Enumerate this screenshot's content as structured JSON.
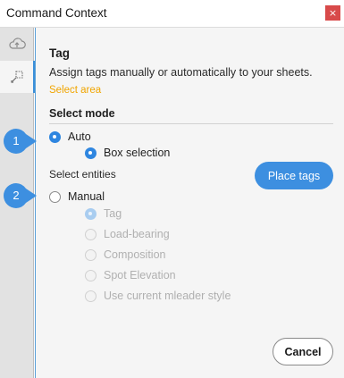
{
  "window": {
    "title": "Command Context",
    "close_glyph": "×"
  },
  "rail": {
    "items": [
      {
        "icon": "cloud-upload-icon"
      },
      {
        "icon": "tag-select-icon"
      }
    ]
  },
  "panel": {
    "heading": "Tag",
    "description": "Assign tags manually or automatically to your sheets.",
    "select_area_link": "Select area",
    "select_mode_label": "Select mode",
    "select_entities_label": "Select entities",
    "auto": {
      "label": "Auto",
      "checked": true
    },
    "box_selection": {
      "label": "Box selection",
      "checked": true
    },
    "manual": {
      "label": "Manual",
      "checked": false
    },
    "manual_options": [
      {
        "label": "Tag",
        "checked": true
      },
      {
        "label": "Load-bearing",
        "checked": false
      },
      {
        "label": "Composition",
        "checked": false
      },
      {
        "label": "Spot Elevation",
        "checked": false
      },
      {
        "label": "Use current mleader style",
        "checked": false
      }
    ],
    "place_tags_button": "Place tags",
    "cancel_button": "Cancel"
  },
  "callouts": [
    "1",
    "2"
  ],
  "colors": {
    "accent": "#3d8fe0",
    "link": "#f0a500",
    "close": "#d84a4a",
    "callout": "#3d8fe0"
  }
}
